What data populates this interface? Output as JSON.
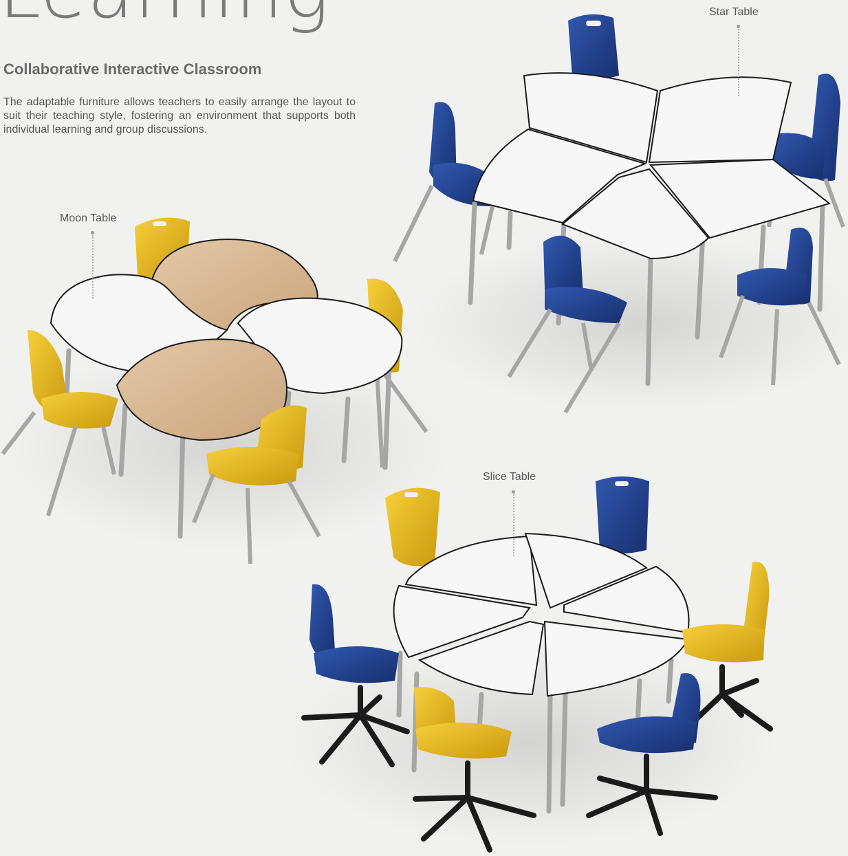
{
  "page": {
    "heading": "Learning",
    "subtitle": "Collaborative Interactive Classroom",
    "description": "The adaptable furniture allows teachers to easily arrange the layout to suit their teaching style, fostering an environment that supports both individual learning and group discussions."
  },
  "callouts": {
    "star": "Star Table",
    "moon": "Moon Table",
    "slice": "Slice Table"
  },
  "colors": {
    "background": "#f1f1f0",
    "chair_blue": "#1f3f8f",
    "chair_yellow": "#e8b81a",
    "tabletop_white": "#f7f7f7",
    "tabletop_wood": "#d9b994",
    "frame_grey": "#a6a6a6",
    "base_black": "#1b1b1b"
  }
}
